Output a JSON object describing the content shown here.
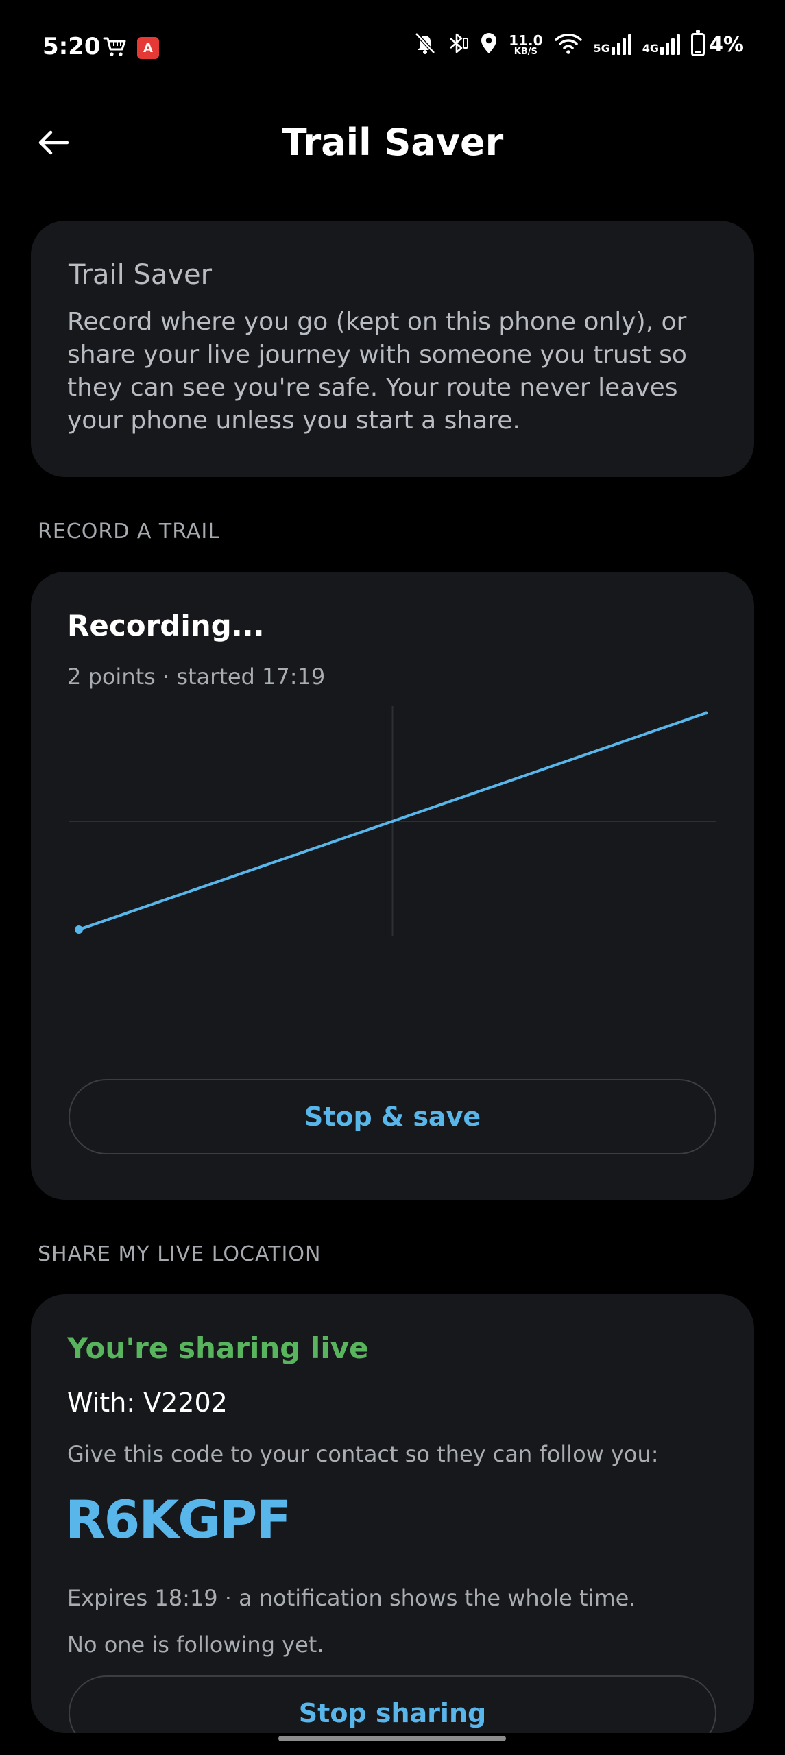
{
  "status_bar": {
    "time": "5:20",
    "left_icons": [
      "shopping-cart-icon",
      "app-notification-icon"
    ],
    "app_icon_glyph": "A",
    "net_speed_value": "11.0",
    "net_speed_unit": "KB/S",
    "net_5g_label": "5G",
    "net_4g_label": "4G",
    "battery": "4%",
    "battery_level": 0.04
  },
  "app_bar": {
    "title": "Trail Saver",
    "back_icon": "arrow-left-icon"
  },
  "intro": {
    "title": "Trail Saver",
    "text": "Record where you go (kept on this phone only),  or share your live journey with someone you trust so they can see you're safe.  Your route never leaves your phone unless you start a share."
  },
  "record": {
    "section_label": "RECORD A TRAIL",
    "status": "Recording...",
    "subtitle": "2 points · started 17:19",
    "stop_button": "Stop & save"
  },
  "share": {
    "section_label": "SHARE MY LIVE LOCATION",
    "status": "You're sharing live",
    "with_label": "With:",
    "with_value": "V2202",
    "instruction": "Give this code to your contact so they can follow you:",
    "code": "R6KGPF",
    "expires": "Expires 18:19 · a notification shows the whole time.",
    "followers": "No one is following yet.",
    "stop_button": "Stop sharing"
  },
  "colors": {
    "background": "#000000",
    "card": "#16181b",
    "accent": "#59b6ea",
    "success": "#58b55d",
    "muted_text": "#a9adb2"
  },
  "chart_data": {
    "type": "line",
    "x": [
      0,
      1
    ],
    "y": [
      0,
      1
    ],
    "xlim": [
      0,
      1
    ],
    "ylim": [
      0,
      1
    ],
    "grid": true,
    "start_marker": true
  }
}
